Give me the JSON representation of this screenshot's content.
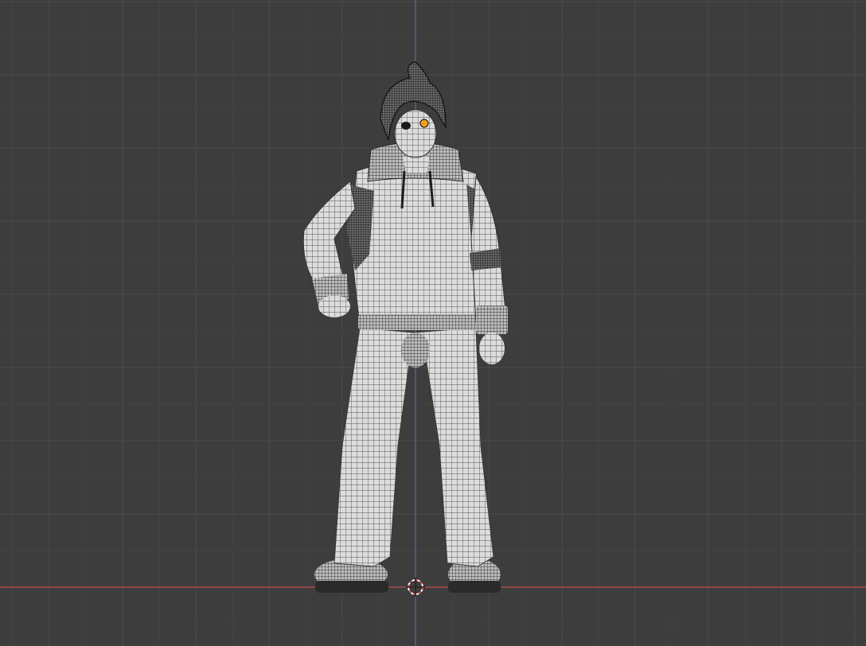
{
  "viewport": {
    "background_color": "#3d3d3d",
    "grid_minor_color": "#434343",
    "grid_major_color": "#4c4c4c",
    "x_axis_color": "#c0504a",
    "z_axis_color": "#4f6fb3"
  },
  "scene_objects": [
    {
      "name": "character-mesh",
      "display": "wireframe-overlay",
      "selected": false
    }
  ],
  "origin_marker": {
    "icon": "origin-icon",
    "color": "#e05050"
  },
  "light_source": {
    "icon": "light-point-icon",
    "color": "#f0a020"
  }
}
